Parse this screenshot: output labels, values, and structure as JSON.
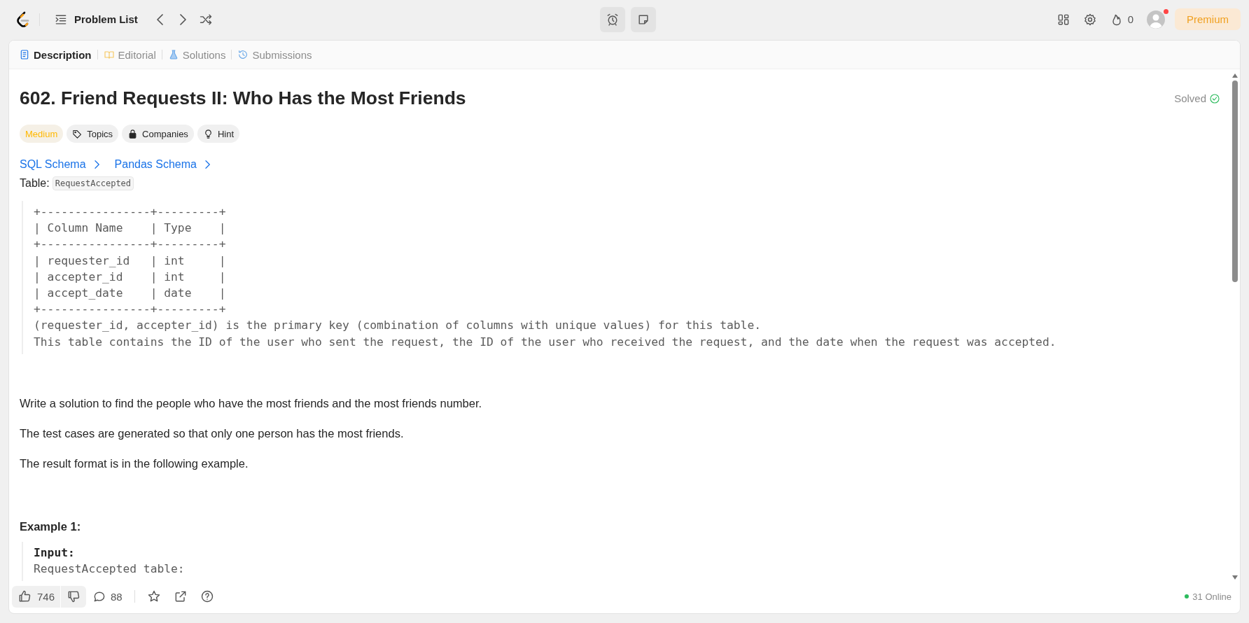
{
  "top_bar": {
    "nav_label": "Problem List",
    "streak_count": "0",
    "notification_dot": true,
    "premium_button": "Premium"
  },
  "tabs": [
    {
      "label": "Description",
      "kind": "description",
      "selected": true
    },
    {
      "label": "Editorial",
      "kind": "editorial",
      "selected": false
    },
    {
      "label": "Solutions",
      "kind": "solutions",
      "selected": false
    },
    {
      "label": "Submissions",
      "kind": "submissions",
      "selected": false
    }
  ],
  "problem": {
    "title": "602. Friend Requests II: Who Has the Most Friends",
    "status": "Solved",
    "difficulty": "Medium",
    "tags": [
      {
        "label": "Topics",
        "kind": "tag"
      },
      {
        "label": "Companies",
        "kind": "lock"
      },
      {
        "label": "Hint",
        "kind": "bulb"
      }
    ],
    "schema_links": [
      "SQL Schema",
      "Pandas Schema"
    ],
    "table_label": "Table:",
    "table_name": "RequestAccepted",
    "schema_block": [
      "+----------------+---------+",
      "| Column Name    | Type    |",
      "+----------------+---------+",
      "| requester_id   | int     |",
      "| accepter_id    | int     |",
      "| accept_date    | date    |",
      "+----------------+---------+",
      "(requester_id, accepter_id) is the primary key (combination of columns with unique values) for this table.",
      "This table contains the ID of the user who sent the request, the ID of the user who received the request, and the date when the request was accepted."
    ],
    "paragraphs": [
      "Write a solution to find the people who have the most friends and the most friends number.",
      "The test cases are generated so that only one person has the most friends.",
      "The result format is in the following example."
    ],
    "example_title": "Example 1:",
    "example_input_label": "Input:",
    "example_input_lines": [
      "RequestAccepted table:"
    ]
  },
  "footer": {
    "likes": "746",
    "comments": "88",
    "online": "31 Online"
  }
}
